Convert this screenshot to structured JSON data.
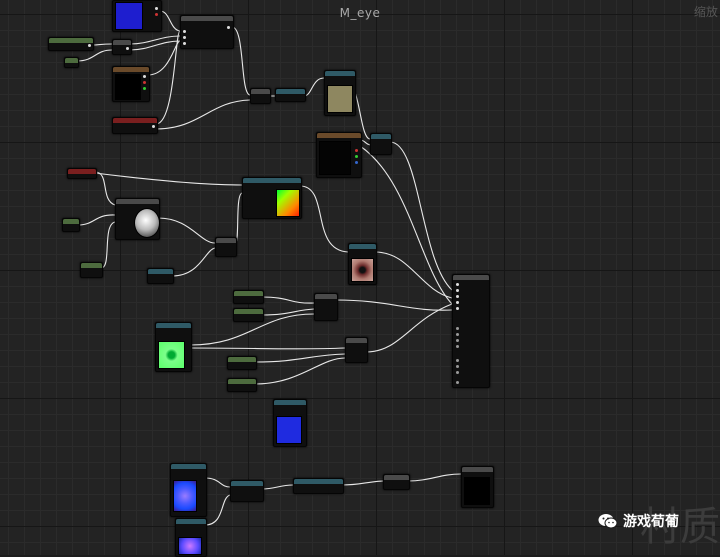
{
  "graph": {
    "title": "M_eye",
    "zoom_label": "缩放 -"
  },
  "watermark": {
    "channel_name": "游戏荀葡",
    "stamp": "村质"
  },
  "colors": {
    "grid_bg": "#232323",
    "wire": "#e8e8e8",
    "header_green": "#4d6b3e",
    "header_teal": "#2f5a66",
    "header_red": "#7a1f1f",
    "pin_red": "#cc3333",
    "pin_green": "#33cc33",
    "pin_blue": "#3366cc"
  }
}
